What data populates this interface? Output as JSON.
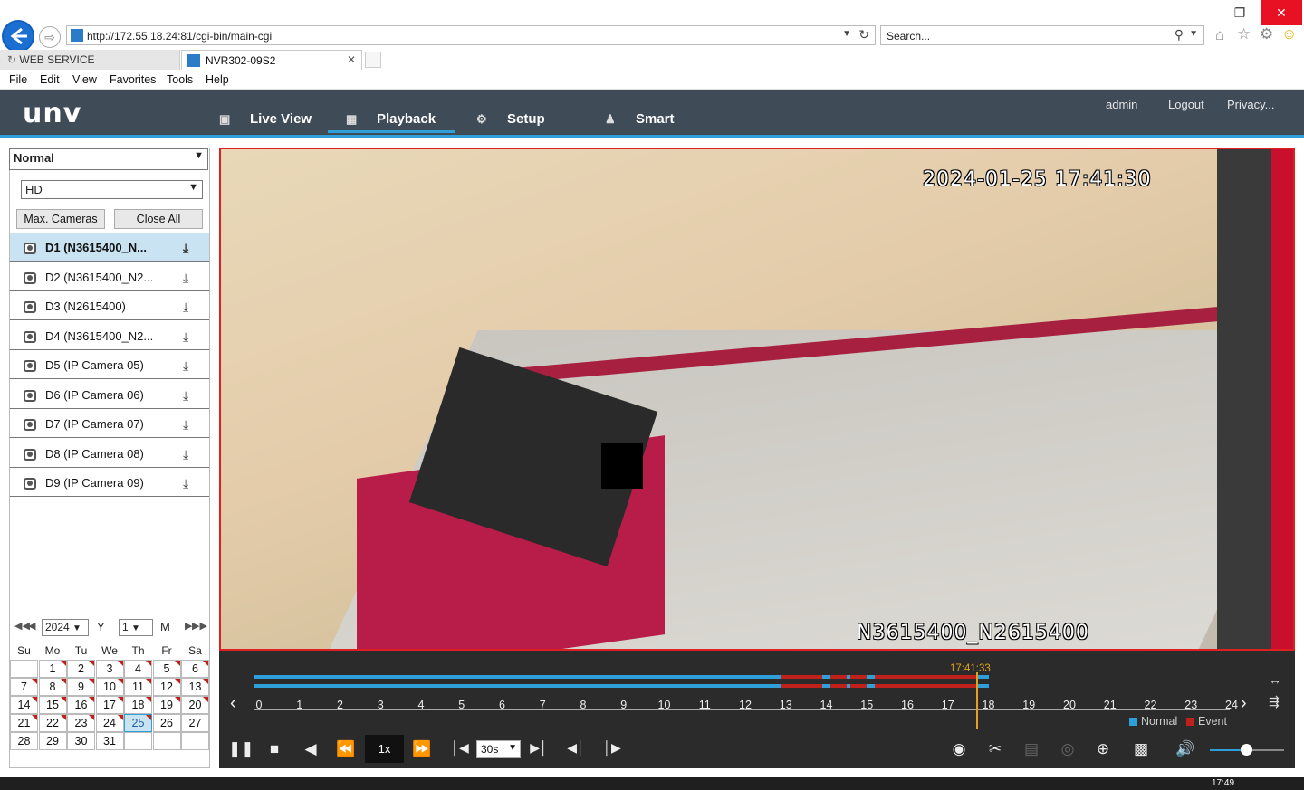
{
  "browser": {
    "url": "http://172.55.18.24:81/cgi-bin/main-cgi",
    "search_placeholder": "Search...",
    "tabs": [
      {
        "label": "WEB SERVICE"
      },
      {
        "label": "NVR302-09S2"
      }
    ],
    "menu": [
      "File",
      "Edit",
      "View",
      "Favorites",
      "Tools",
      "Help"
    ]
  },
  "app": {
    "logo": "unv",
    "nav": [
      {
        "label": "Live View",
        "icon": "monitor-icon"
      },
      {
        "label": "Playback",
        "icon": "film-icon",
        "active": true
      },
      {
        "label": "Setup",
        "icon": "gear-icon"
      },
      {
        "label": "Smart",
        "icon": "person-scan-icon"
      }
    ],
    "header_links": [
      "admin",
      "Logout",
      "Privacy..."
    ]
  },
  "left_panel": {
    "mode": "Normal",
    "stream": "HD",
    "max_cameras_label": "Max. Cameras",
    "close_all_label": "Close All",
    "cameras": [
      {
        "label": "D1 (N3615400_N...",
        "selected": true
      },
      {
        "label": "D2 (N3615400_N2..."
      },
      {
        "label": "D3 (N2615400)"
      },
      {
        "label": "D4 (N3615400_N2..."
      },
      {
        "label": "D5 (IP Camera 05)"
      },
      {
        "label": "D6 (IP Camera 06)"
      },
      {
        "label": "D7 (IP Camera 07)"
      },
      {
        "label": "D8 (IP Camera 08)"
      },
      {
        "label": "D9 (IP Camera 09)"
      }
    ]
  },
  "calendar": {
    "year": "2024",
    "year_label": "Y",
    "month": "1",
    "month_label": "M",
    "weekdays": [
      "Su",
      "Mo",
      "Tu",
      "We",
      "Th",
      "Fr",
      "Sa"
    ],
    "days": [
      "",
      "1",
      "2",
      "3",
      "4",
      "5",
      "6",
      "7",
      "8",
      "9",
      "10",
      "11",
      "12",
      "13",
      "14",
      "15",
      "16",
      "17",
      "18",
      "19",
      "20",
      "21",
      "22",
      "23",
      "24",
      "25",
      "26",
      "27",
      "28",
      "29",
      "30",
      "31"
    ],
    "selected_day": "25",
    "recorded_days": [
      "1",
      "2",
      "3",
      "4",
      "5",
      "6",
      "7",
      "8",
      "9",
      "10",
      "11",
      "12",
      "13",
      "14",
      "15",
      "16",
      "17",
      "18",
      "19",
      "20",
      "21",
      "22",
      "23",
      "24",
      "25"
    ]
  },
  "video": {
    "timestamp": "2024-01-25 17:41:30",
    "camera_name": "N3615400_N2615400"
  },
  "timeline": {
    "current_time": "17:41:33",
    "hours": [
      "0",
      "1",
      "2",
      "3",
      "4",
      "5",
      "6",
      "7",
      "8",
      "9",
      "10",
      "11",
      "12",
      "13",
      "14",
      "15",
      "16",
      "17",
      "18",
      "19",
      "20",
      "21",
      "22",
      "23",
      "24"
    ],
    "current_hour": 17.69,
    "normal_ranges": [
      [
        0,
        18
      ]
    ],
    "event_ranges": [
      [
        12.9,
        13.9
      ],
      [
        14.1,
        14.5
      ],
      [
        14.6,
        15.0
      ],
      [
        15.2,
        17.7
      ]
    ],
    "legend": [
      {
        "label": "Normal",
        "color": "#2e9fd8"
      },
      {
        "label": "Event",
        "color": "#c0221b"
      }
    ]
  },
  "controls": {
    "speed": "1x",
    "interval": "30s"
  },
  "taskbar": {
    "clock": "17:49"
  }
}
